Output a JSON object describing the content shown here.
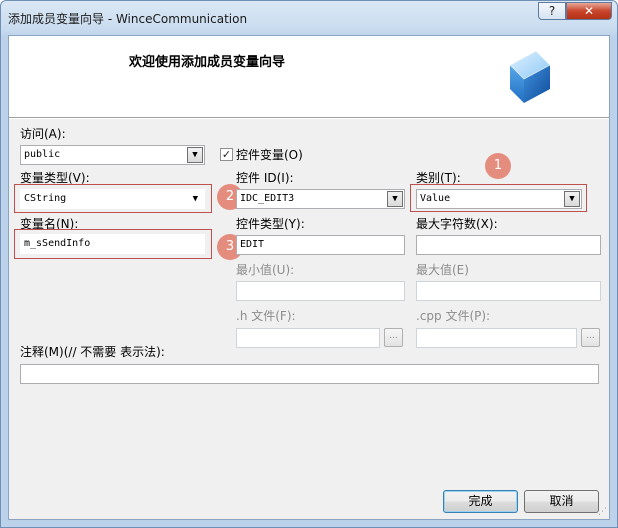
{
  "window": {
    "title": "添加成员变量向导 - WinceCommunication",
    "help_label": "?",
    "close_label": "✕"
  },
  "banner": {
    "text": "欢迎使用添加成员变量向导",
    "icon": "blue-cube-icon"
  },
  "access": {
    "label": "访问(A):",
    "value": "public"
  },
  "control_var": {
    "label": "控件变量(O)",
    "checked": true,
    "check_mark": "✓"
  },
  "var_type": {
    "label": "变量类型(V):",
    "value": "CString"
  },
  "control_id": {
    "label": "控件 ID(I):",
    "value": "IDC_EDIT3"
  },
  "category": {
    "label": "类别(T):",
    "value": "Value"
  },
  "var_name": {
    "label": "变量名(N):",
    "value": "m_sSendInfo"
  },
  "control_type": {
    "label": "控件类型(Y):",
    "value": "EDIT"
  },
  "max_chars": {
    "label": "最大字符数(X):",
    "value": ""
  },
  "min_value": {
    "label": "最小值(U):",
    "value": ""
  },
  "max_value": {
    "label": "最大值(E)",
    "value": ""
  },
  "h_file": {
    "label": ".h 文件(F):",
    "value": "",
    "browse": "..."
  },
  "cpp_file": {
    "label": ".cpp 文件(P):",
    "value": "",
    "browse": "..."
  },
  "comment": {
    "label": "注释(M)(// 不需要 表示法):",
    "value": ""
  },
  "buttons": {
    "finish": "完成",
    "cancel": "取消"
  },
  "annotations": [
    "1",
    "2",
    "3"
  ],
  "colors": {
    "highlight": "#c0504d",
    "badge": "#e48d7e",
    "title_bar": "#c9dcef"
  }
}
